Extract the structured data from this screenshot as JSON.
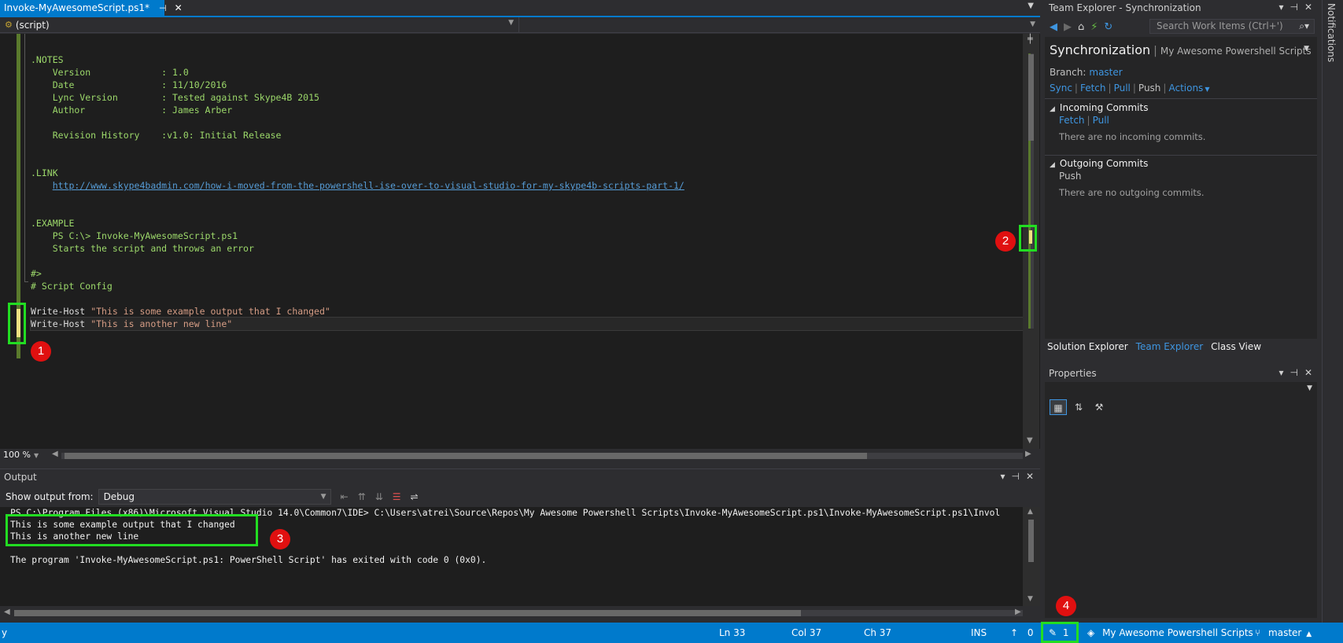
{
  "tab": {
    "title": "Invoke-MyAwesomeScript.ps1*",
    "pin": "⊣",
    "close": "✕"
  },
  "navbar": {
    "scope": "(script)"
  },
  "editor": {
    "lines": [
      {
        "t": "code",
        "text": ".NOTES"
      },
      {
        "t": "code",
        "text": "    Version             : 1.0"
      },
      {
        "t": "code",
        "text": "    Date                : 11/10/2016"
      },
      {
        "t": "code",
        "text": "    Lync Version        : Tested against Skype4B 2015"
      },
      {
        "t": "code",
        "text": "    Author              : James Arber"
      },
      {
        "t": "blank",
        "text": ""
      },
      {
        "t": "code",
        "text": "    Revision History    :v1.0: Initial Release"
      },
      {
        "t": "blank",
        "text": ""
      },
      {
        "t": "blank",
        "text": ""
      },
      {
        "t": "code",
        "text": ".LINK"
      },
      {
        "t": "link",
        "text": "http://www.skype4badmin.com/how-i-moved-from-the-powershell-ise-over-to-visual-studio-for-my-skype4b-scripts-part-1/"
      },
      {
        "t": "blank",
        "text": ""
      },
      {
        "t": "blank",
        "text": ""
      },
      {
        "t": "code",
        "text": ".EXAMPLE"
      },
      {
        "t": "code",
        "text": "    PS C:\\> Invoke-MyAwesomeScript.ps1"
      },
      {
        "t": "code",
        "text": "    Starts the script and throws an error"
      },
      {
        "t": "blank",
        "text": ""
      },
      {
        "t": "code",
        "text": "#>"
      },
      {
        "t": "code",
        "text": "# Script Config"
      },
      {
        "t": "blank",
        "text": ""
      },
      {
        "t": "cmd",
        "cmd": "Write-Host",
        "str": "\"This is some example output that I changed\""
      },
      {
        "t": "cmd",
        "cmd": "Write-Host",
        "str": "\"This is another new line\""
      }
    ],
    "zoom": "100 %"
  },
  "output": {
    "title": "Output",
    "from_label": "Show output from:",
    "source": "Debug",
    "lines": [
      "PS C:\\Program Files (x86)\\Microsoft Visual Studio 14.0\\Common7\\IDE> C:\\Users\\atrei\\Source\\Repos\\My Awesome Powershell Scripts\\Invoke-MyAwesomeScript.ps1\\Invoke-MyAwesomeScript.ps1\\Invol",
      "This is some example output that I changed",
      "This is another new line",
      "",
      "The program 'Invoke-MyAwesomeScript.ps1: PowerShell Script' has exited with code 0 (0x0)."
    ]
  },
  "team_explorer": {
    "title": "Team Explorer - Synchronization",
    "search_placeholder": "Search Work Items (Ctrl+')",
    "heading": "Synchronization",
    "repo": "My Awesome Powershell Scripts",
    "branch_label": "Branch:",
    "branch": "master",
    "actions": {
      "sync": "Sync",
      "fetch": "Fetch",
      "pull": "Pull",
      "push": "Push",
      "more": "Actions"
    },
    "incoming": {
      "title": "Incoming Commits",
      "fetch": "Fetch",
      "pull": "Pull",
      "message": "There are no incoming commits."
    },
    "outgoing": {
      "title": "Outgoing Commits",
      "push": "Push",
      "message": "There are no outgoing commits."
    }
  },
  "bottom_tabs": [
    "Solution Explorer",
    "Team Explorer",
    "Class View"
  ],
  "properties": {
    "title": "Properties"
  },
  "notifications": "Notifications",
  "status": {
    "left": "y",
    "ln": "Ln 33",
    "col": "Col 37",
    "ch": "Ch 37",
    "ins": "INS",
    "up_count": "0",
    "pending": "1",
    "repo": "My Awesome Powershell Scripts",
    "branch": "master"
  },
  "annotations": [
    "1",
    "2",
    "3",
    "4"
  ],
  "colors": {
    "accent": "#007acc",
    "highlight": "#22dd22",
    "badge": "#e01010",
    "change_marker": "#efe080"
  }
}
